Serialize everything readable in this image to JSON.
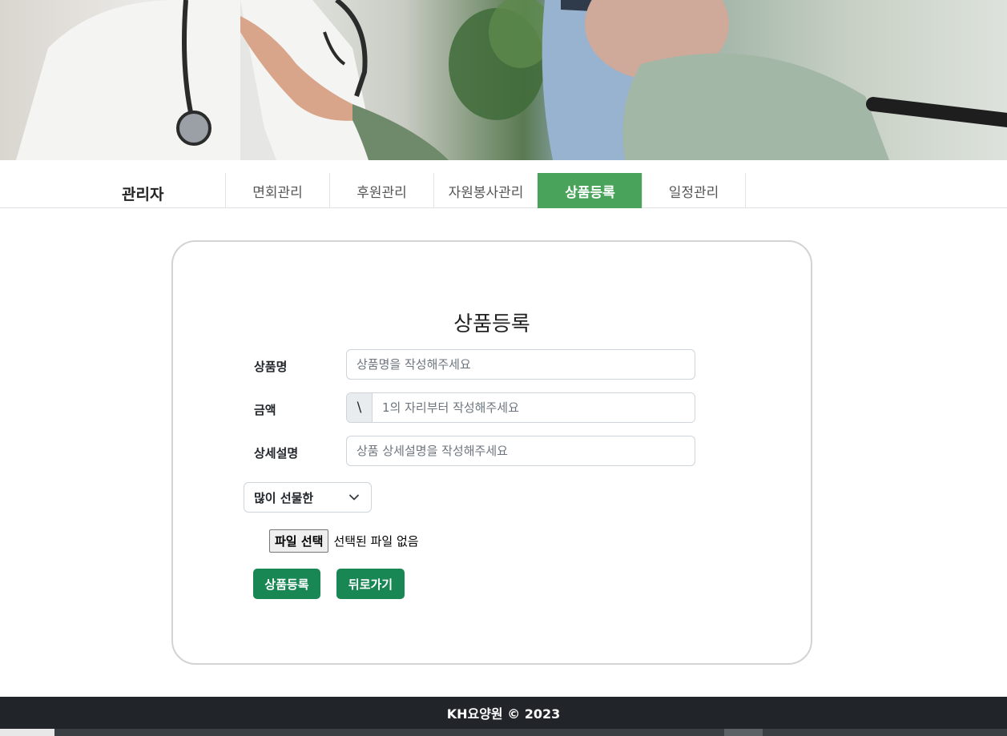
{
  "nav": {
    "brand": "관리자",
    "items": [
      "면회관리",
      "후원관리",
      "자원봉사관리",
      "상품등록",
      "일정관리"
    ],
    "active_index": 3
  },
  "form": {
    "title": "상품등록",
    "name_label": "상품명",
    "name_placeholder": "상품명을 작성해주세요",
    "price_label": "금액",
    "price_addon": "\\",
    "price_placeholder": "1의 자리부터 작성해주세요",
    "desc_label": "상세설명",
    "desc_placeholder": "상품 상세설명을 작성해주세요",
    "category_selected": "많이 선물한",
    "file_button": "파일 선택",
    "file_status": "선택된 파일 없음",
    "submit_button": "상품등록",
    "back_button": "뒤로가기"
  },
  "footer": {
    "text": "KH요양원 © 2023"
  },
  "colors": {
    "active_tab": "#4aa35a",
    "button": "#198754",
    "footer_bg": "#212529"
  }
}
